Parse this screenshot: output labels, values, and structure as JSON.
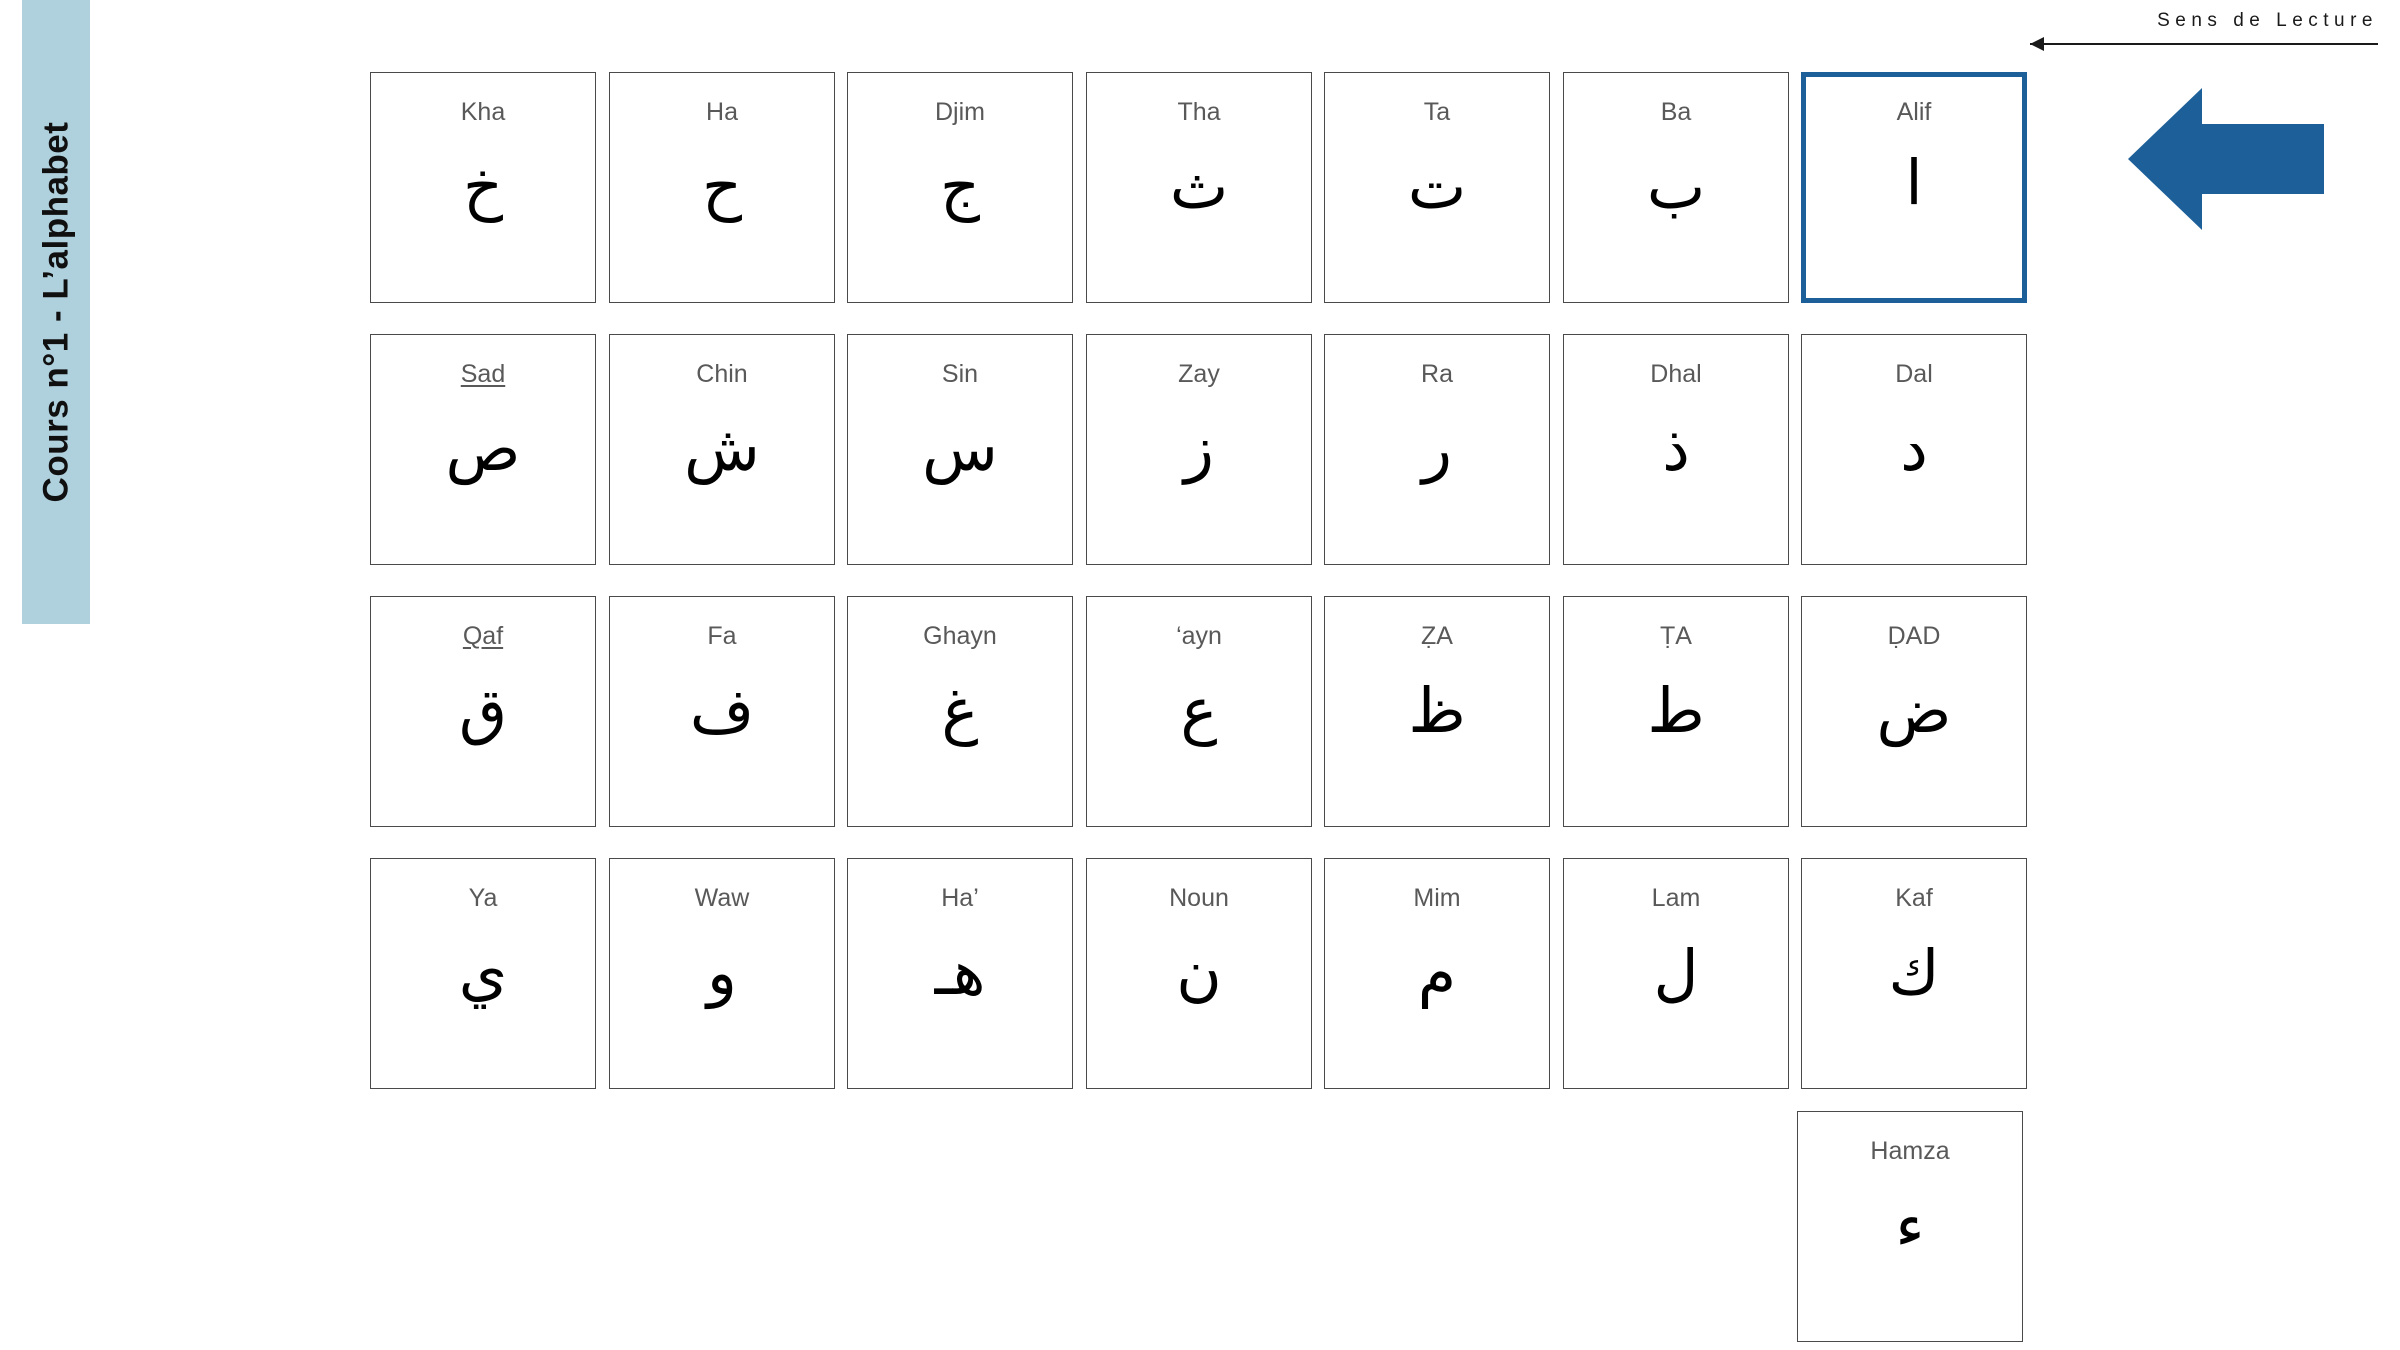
{
  "sidebar": {
    "title": "Cours n°1  -  L’alphabet",
    "band_color": "#afd1de"
  },
  "header": {
    "reading_direction_label": "Sens de Lecture",
    "arrow_direction": "left"
  },
  "direction_arrow": {
    "name": "big-left-arrow",
    "color": "#1d6099",
    "direction": "left"
  },
  "grid": {
    "columns": 7,
    "highlight_color": "#1d6099",
    "rows": [
      {
        "cards": [
          {
            "name": "Kha",
            "glyph": "خ",
            "underlined": false,
            "highlight": false
          },
          {
            "name": "Ha",
            "glyph": "ح",
            "underlined": false,
            "highlight": false
          },
          {
            "name": "Djim",
            "glyph": "ج",
            "underlined": false,
            "highlight": false
          },
          {
            "name": "Tha",
            "glyph": "ث",
            "underlined": false,
            "highlight": false
          },
          {
            "name": "Ta",
            "glyph": "ت",
            "underlined": false,
            "highlight": false
          },
          {
            "name": "Ba",
            "glyph": "ب",
            "underlined": false,
            "highlight": false
          },
          {
            "name": "Alif",
            "glyph": "ا",
            "underlined": false,
            "highlight": true
          }
        ]
      },
      {
        "cards": [
          {
            "name": "Sad",
            "glyph": "ص",
            "underlined": true,
            "highlight": false
          },
          {
            "name": "Chin",
            "glyph": "ش",
            "underlined": false,
            "highlight": false
          },
          {
            "name": "Sin",
            "glyph": "س",
            "underlined": false,
            "highlight": false
          },
          {
            "name": "Zay",
            "glyph": "ز",
            "underlined": false,
            "highlight": false
          },
          {
            "name": "Ra",
            "glyph": "ر",
            "underlined": false,
            "highlight": false
          },
          {
            "name": "Dhal",
            "glyph": "ذ",
            "underlined": false,
            "highlight": false
          },
          {
            "name": "Dal",
            "glyph": "د",
            "underlined": false,
            "highlight": false
          }
        ]
      },
      {
        "cards": [
          {
            "name": "Qaf",
            "glyph": "ق",
            "underlined": true,
            "highlight": false
          },
          {
            "name": "Fa",
            "glyph": "ف",
            "underlined": false,
            "highlight": false
          },
          {
            "name": "Ghayn",
            "glyph": "غ",
            "underlined": false,
            "highlight": false
          },
          {
            "name": "‘ayn",
            "glyph": "ع",
            "underlined": false,
            "highlight": false
          },
          {
            "name": "ẒA",
            "glyph": "ظ",
            "underlined": false,
            "highlight": false
          },
          {
            "name": "ṬA",
            "glyph": "ط",
            "underlined": false,
            "highlight": false
          },
          {
            "name": "ḌAD",
            "glyph": "ض",
            "underlined": false,
            "highlight": false
          }
        ]
      },
      {
        "cards": [
          {
            "name": "Ya",
            "glyph": "ي",
            "underlined": false,
            "highlight": false
          },
          {
            "name": "Waw",
            "glyph": "و",
            "underlined": false,
            "highlight": false
          },
          {
            "name": "Ha’",
            "glyph": "هـ",
            "underlined": false,
            "highlight": false
          },
          {
            "name": "Noun",
            "glyph": "ن",
            "underlined": false,
            "highlight": false
          },
          {
            "name": "Mim",
            "glyph": "م",
            "underlined": false,
            "highlight": false
          },
          {
            "name": "Lam",
            "glyph": "ل",
            "underlined": false,
            "highlight": false
          },
          {
            "name": "Kaf",
            "glyph": "ك",
            "underlined": false,
            "highlight": false
          }
        ]
      }
    ],
    "trailing_card": {
      "name": "Hamza",
      "glyph": "ء",
      "underlined": false,
      "highlight": false
    }
  }
}
